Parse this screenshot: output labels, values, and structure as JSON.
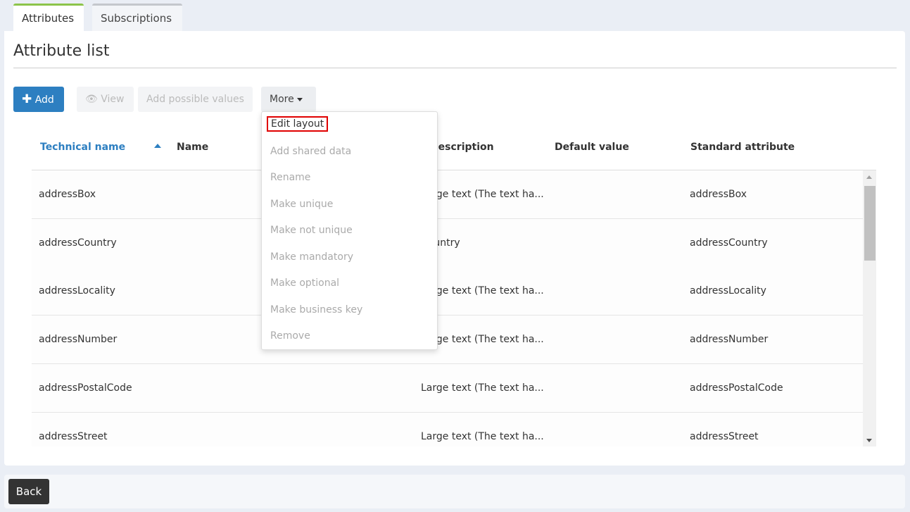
{
  "tabs": [
    "Attributes",
    "Subscriptions"
  ],
  "title": "Attribute list",
  "toolbar": {
    "add": "Add",
    "view": "View",
    "add_possible_values": "Add possible values",
    "more": "More"
  },
  "columns": [
    "Technical name",
    "Name",
    "Value description",
    "Default value",
    "Standard attribute"
  ],
  "sort": {
    "column": "Technical name",
    "direction": "ascending"
  },
  "rows": [
    {
      "technical_name": "addressBox",
      "value_description": "Large text (The text ha...",
      "standard_attribute": "addressBox"
    },
    {
      "technical_name": "addressCountry",
      "value_description": "Country",
      "standard_attribute": "addressCountry"
    },
    {
      "technical_name": "addressLocality",
      "value_description": "Large text (The text ha...",
      "standard_attribute": "addressLocality"
    },
    {
      "technical_name": "addressNumber",
      "value_description": "Large text (The text ha...",
      "standard_attribute": "addressNumber"
    },
    {
      "technical_name": "addressPostalCode",
      "value_description": "Large text (The text ha...",
      "standard_attribute": "addressPostalCode"
    },
    {
      "technical_name": "addressStreet",
      "value_description": "Large text (The text ha...",
      "standard_attribute": "addressStreet"
    }
  ],
  "more_menu": [
    "Edit layout",
    "Add shared data",
    "Rename",
    "Make unique",
    "Make not unique",
    "Make mandatory",
    "Make optional",
    "Make business key",
    "Remove"
  ],
  "back": "Back",
  "colors": {
    "primary": "#2d7fc1",
    "active_tab": "#8cc44a",
    "highlight": "#e00000"
  }
}
